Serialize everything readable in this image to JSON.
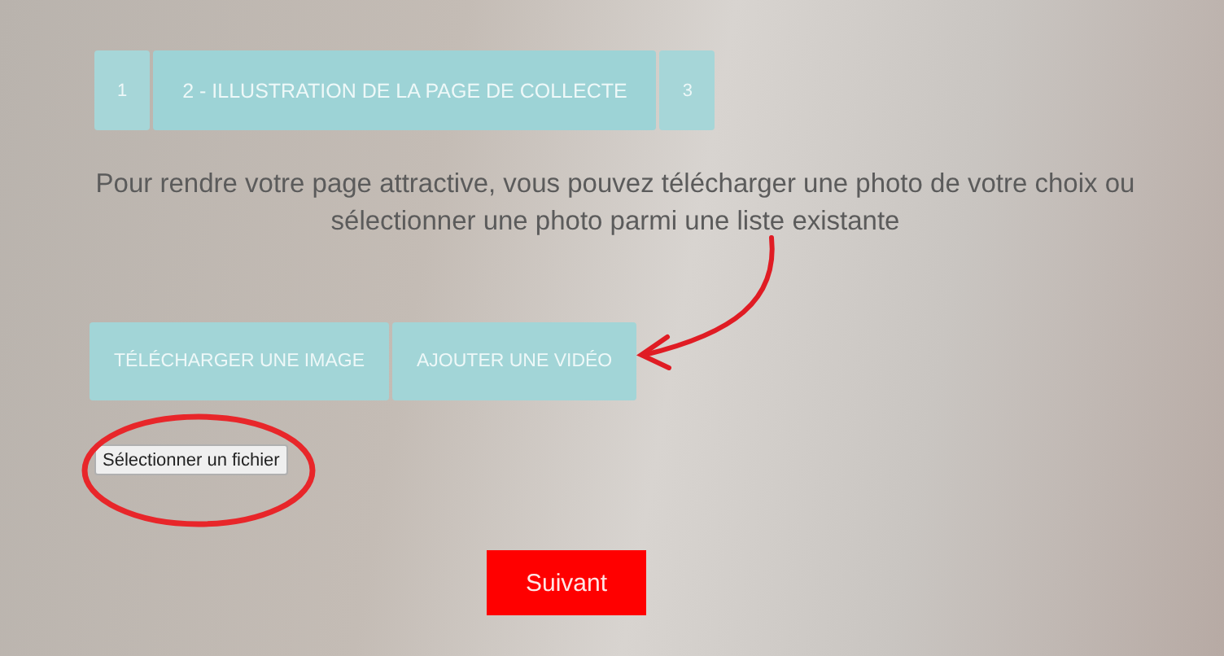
{
  "steps": [
    {
      "label": "1",
      "selected": false
    },
    {
      "label": "2 - ILLUSTRATION DE LA PAGE DE COLLECTE",
      "selected": true
    },
    {
      "label": "3",
      "selected": false
    }
  ],
  "intro": "Pour rendre votre page attractive, vous pouvez télécharger une photo de votre choix ou sélectionner une photo parmi une liste existante",
  "media_buttons": [
    "TÉLÉCHARGER UNE IMAGE",
    "AJOUTER UNE VIDÉO"
  ],
  "file_button": "Sélectionner un fichier",
  "next_button": "Suivant"
}
